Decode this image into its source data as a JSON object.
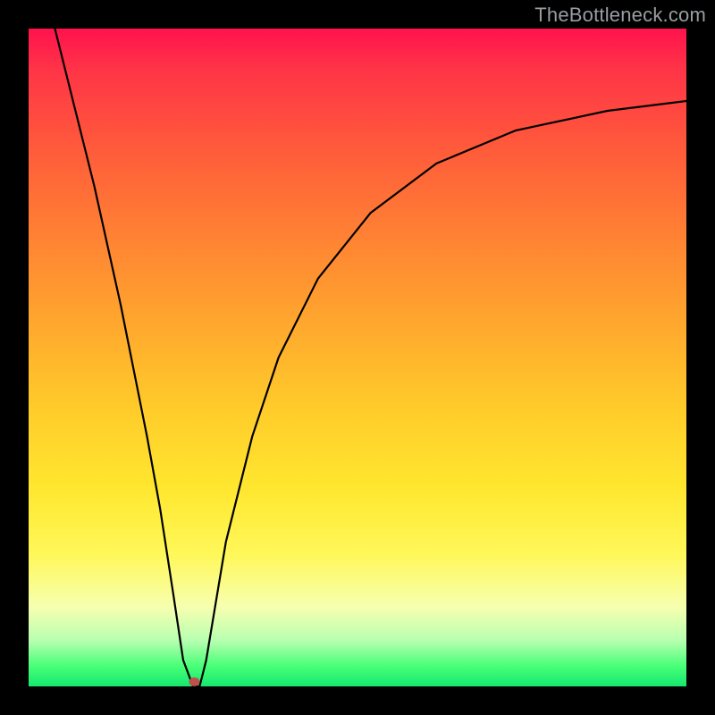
{
  "watermark": "TheBottleneck.com",
  "chart_data": {
    "type": "line",
    "title": "",
    "xlabel": "",
    "ylabel": "",
    "xlim": [
      0,
      100
    ],
    "ylim": [
      0,
      100
    ],
    "grid": false,
    "series": [
      {
        "name": "curve",
        "x": [
          4,
          6,
          8,
          10,
          12,
          14,
          16,
          18,
          20,
          22,
          23.5,
          25,
          26,
          27,
          30,
          34,
          38,
          44,
          52,
          62,
          74,
          88,
          100
        ],
        "y": [
          100,
          92,
          84,
          76,
          67,
          58,
          48,
          38,
          27,
          14,
          4,
          0,
          0,
          4,
          22,
          38,
          50,
          62,
          72,
          79.5,
          84.5,
          87.5,
          89
        ]
      }
    ],
    "marker": {
      "x": 25.2,
      "y": 0.7,
      "color": "#c0504d",
      "size": 10
    }
  }
}
